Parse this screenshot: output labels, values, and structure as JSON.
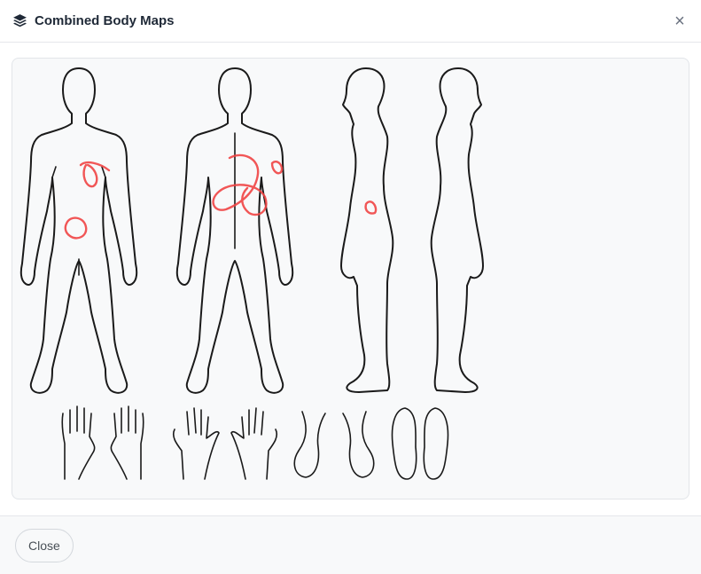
{
  "dialog": {
    "title": "Combined Body Maps",
    "title_icon": "layers-icon",
    "close_icon": "close-icon",
    "close_symbol": "×"
  },
  "body_map": {
    "views": [
      "front",
      "back",
      "right-side",
      "left-side"
    ],
    "extremities": [
      "hands-palm",
      "hands-back",
      "feet-top",
      "feet-soles"
    ],
    "marking_color": "#ef4444",
    "outline_color": "#1a1a1a"
  },
  "footer": {
    "close_label": "Close"
  }
}
